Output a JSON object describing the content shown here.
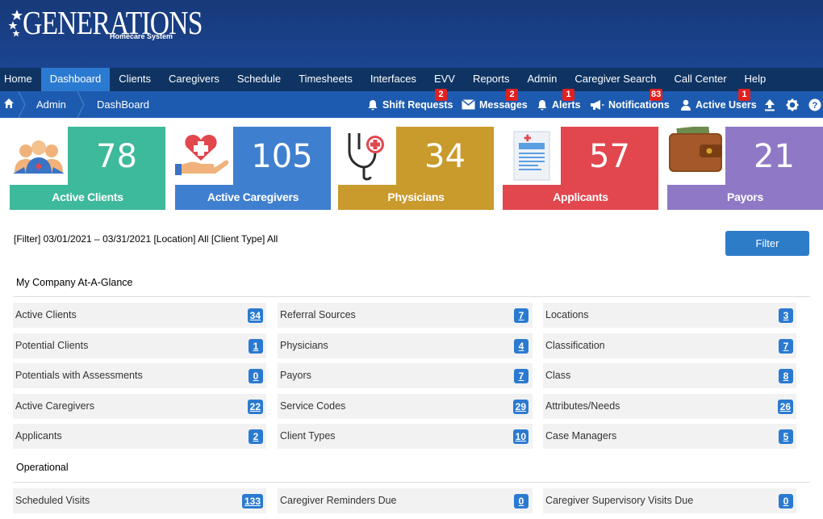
{
  "brand": {
    "name": "GENERATIONS",
    "sub": "Homecare System"
  },
  "nav": [
    "Home",
    "Dashboard",
    "Clients",
    "Caregivers",
    "Schedule",
    "Timesheets",
    "Interfaces",
    "EVV",
    "Reports",
    "Admin",
    "Caregiver Search",
    "Call Center",
    "Help"
  ],
  "nav_active": "Dashboard",
  "breadcrumb": [
    "Admin",
    "DashBoard"
  ],
  "toolbar": {
    "shift_requests": {
      "label": "Shift Requests",
      "badge": "2"
    },
    "messages": {
      "label": "Messages",
      "badge": "2"
    },
    "alerts": {
      "label": "Alerts",
      "badge": "1"
    },
    "notifications": {
      "label": "Notifications",
      "badge": "83"
    },
    "active_users": {
      "label": "Active Users",
      "badge": "1"
    }
  },
  "tiles": [
    {
      "value": "78",
      "label": "Active Clients",
      "color": "#3db99b"
    },
    {
      "value": "105",
      "label": "Active Caregivers",
      "color": "#3f7fcf"
    },
    {
      "value": "34",
      "label": "Physicians",
      "color": "#c99a2c"
    },
    {
      "value": "57",
      "label": "Applicants",
      "color": "#e2474e"
    },
    {
      "value": "21",
      "label": "Payors",
      "color": "#8f79c6"
    }
  ],
  "filter": {
    "summary": "[Filter] 03/01/2021 – 03/31/2021 [Location] All [Client Type] All",
    "button": "Filter"
  },
  "sections": {
    "company": "My Company At-A-Glance",
    "operational": "Operational"
  },
  "company_rows": [
    [
      {
        "label": "Active Clients",
        "count": "34"
      },
      {
        "label": "Referral Sources",
        "count": "7"
      },
      {
        "label": "Locations",
        "count": "3"
      }
    ],
    [
      {
        "label": "Potential Clients",
        "count": "1"
      },
      {
        "label": "Physicians",
        "count": "4"
      },
      {
        "label": "Classification",
        "count": "7"
      }
    ],
    [
      {
        "label": "Potentials with Assessments",
        "count": "0"
      },
      {
        "label": "Payors",
        "count": "7"
      },
      {
        "label": "Class",
        "count": "8"
      }
    ],
    [
      {
        "label": "Active Caregivers",
        "count": "22"
      },
      {
        "label": "Service Codes",
        "count": "29"
      },
      {
        "label": "Attributes/Needs",
        "count": "26"
      }
    ],
    [
      {
        "label": "Applicants",
        "count": "2"
      },
      {
        "label": "Client Types",
        "count": "10"
      },
      {
        "label": "Case Managers",
        "count": "5"
      }
    ]
  ],
  "operational_rows": [
    [
      {
        "label": "Scheduled Visits",
        "count": "133"
      },
      {
        "label": "Caregiver Reminders Due",
        "count": "0"
      },
      {
        "label": "Caregiver Supervisory Visits Due",
        "count": "0"
      }
    ]
  ]
}
